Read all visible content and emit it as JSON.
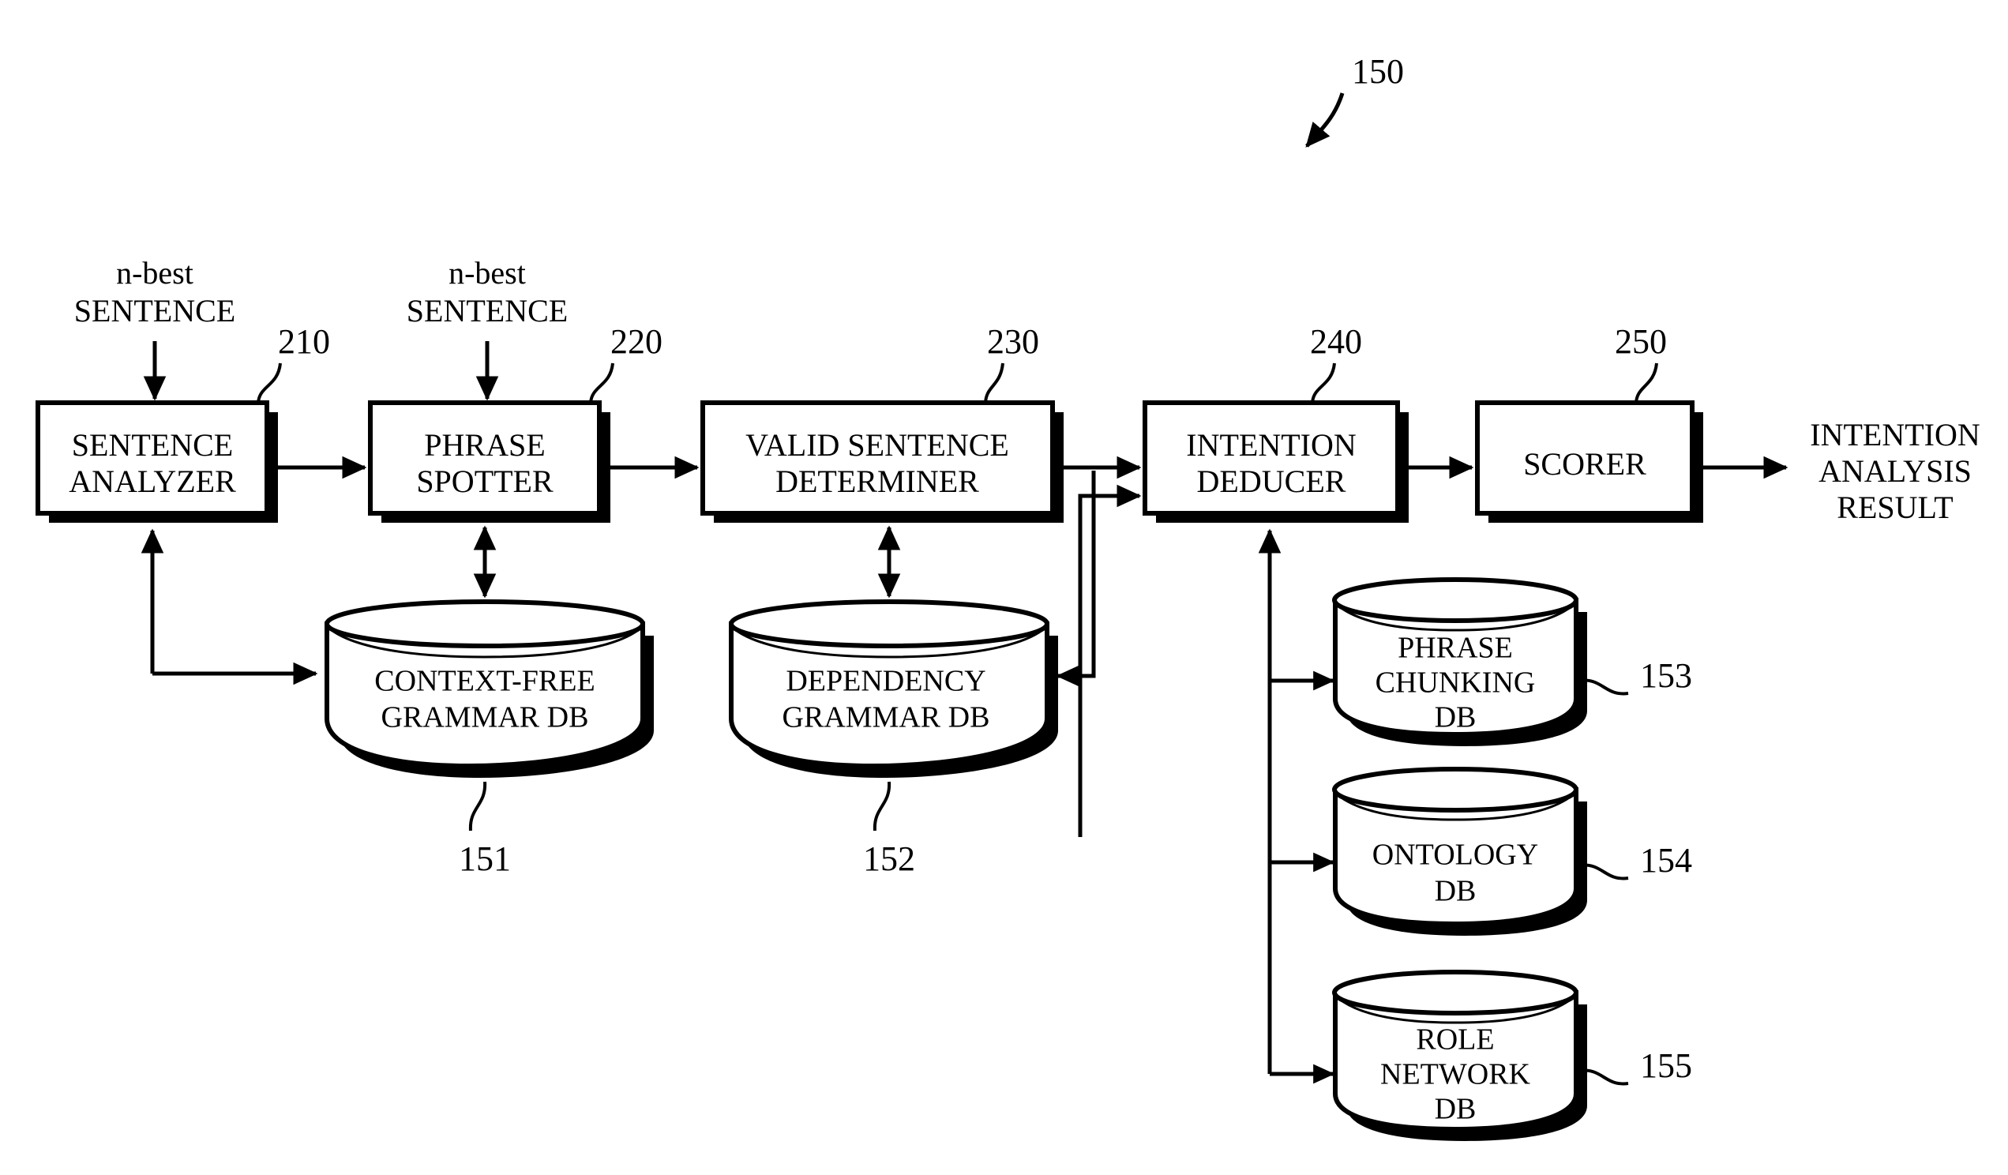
{
  "figure": {
    "top_reference": "150",
    "inputs": [
      {
        "line1": "n-best",
        "line2": "SENTENCE"
      },
      {
        "line1": "n-best",
        "line2": "SENTENCE"
      }
    ],
    "output": {
      "line1": "INTENTION",
      "line2": "ANALYSIS",
      "line3": "RESULT"
    }
  },
  "blocks": [
    {
      "id": "sentence-analyzer",
      "line1": "SENTENCE",
      "line2": "ANALYZER",
      "ref": "210"
    },
    {
      "id": "phrase-spotter",
      "line1": "PHRASE",
      "line2": "SPOTTER",
      "ref": "220"
    },
    {
      "id": "valid-sentence-determiner",
      "line1": "VALID SENTENCE",
      "line2": "DETERMINER",
      "ref": "230"
    },
    {
      "id": "intention-deducer",
      "line1": "INTENTION",
      "line2": "DEDUCER",
      "ref": "240"
    },
    {
      "id": "scorer",
      "line1": "SCORER",
      "line2": "",
      "ref": "250"
    }
  ],
  "databases": [
    {
      "id": "context-free-grammar-db",
      "line1": "CONTEXT-FREE",
      "line2": "GRAMMAR DB",
      "line3": "",
      "ref": "151"
    },
    {
      "id": "dependency-grammar-db",
      "line1": "DEPENDENCY",
      "line2": "GRAMMAR DB",
      "line3": "",
      "ref": "152"
    },
    {
      "id": "phrase-chunking-db",
      "line1": "PHRASE",
      "line2": "CHUNKING",
      "line3": "DB",
      "ref": "153"
    },
    {
      "id": "ontology-db",
      "line1": "ONTOLOGY",
      "line2": "DB",
      "line3": "",
      "ref": "154"
    },
    {
      "id": "role-network-db",
      "line1": "ROLE",
      "line2": "NETWORK",
      "line3": "DB",
      "ref": "155"
    }
  ],
  "colors": {
    "stroke": "#000000",
    "fill": "#ffffff"
  }
}
